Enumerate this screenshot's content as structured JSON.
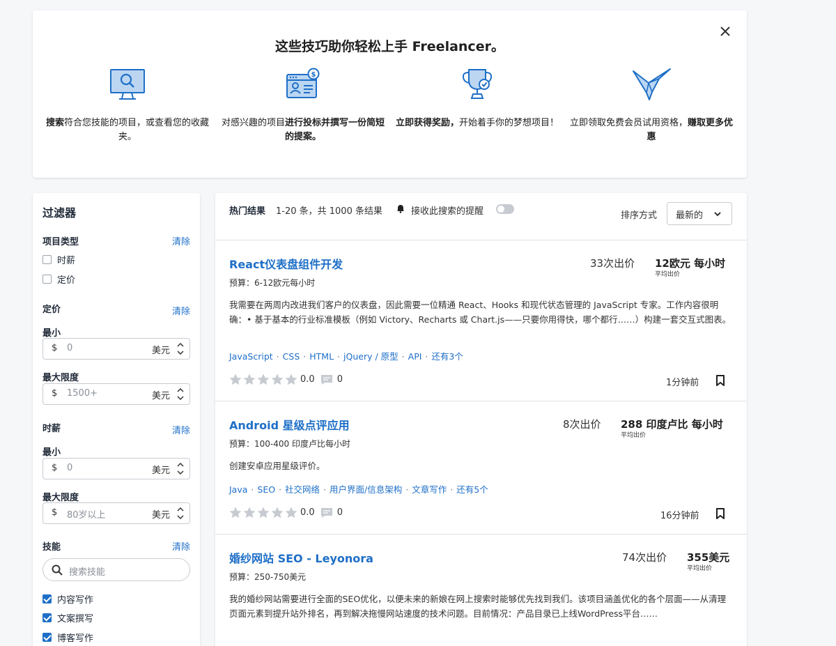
{
  "colors": {
    "accent": "#1e6fc7",
    "star": "#c7cbd1",
    "icon_fill": "#bcd6f2"
  },
  "tips": {
    "title": "这些技巧助你轻松上手 Freelancer。",
    "close_icon": "close-icon",
    "items": [
      {
        "icon": "monitor-search-icon",
        "bold1": "搜索",
        "text1": "符合您技能的项目，或查看您的收藏夹。",
        "bold2": "",
        "text2": ""
      },
      {
        "icon": "proposal-card-icon",
        "bold1": "",
        "text1": "对感兴趣的项目",
        "bold2": "进行投标并撰写一份简短的提案。",
        "text2": ""
      },
      {
        "icon": "trophy-icon",
        "bold1": "立即获得奖励，",
        "text1": "开始着手你的梦想项目！",
        "bold2": "",
        "text2": ""
      },
      {
        "icon": "bird-icon",
        "bold1": "",
        "text1": "立即领取免费会员试用资格，",
        "bold2": "赚取更多优惠",
        "text2": ""
      }
    ]
  },
  "filters": {
    "title": "过滤器",
    "project_type": {
      "label": "项目类型",
      "clear": "清除",
      "options": [
        "时薪",
        "定价"
      ]
    },
    "fixed": {
      "label": "定价",
      "clear": "清除",
      "min_label": "最小",
      "min_value": "0",
      "max_label": "最大限度",
      "max_value": "1500+",
      "currency": "$",
      "unit": "美元"
    },
    "hourly": {
      "label": "时薪",
      "clear": "清除",
      "min_label": "最小",
      "min_value": "0",
      "max_label": "最大限度",
      "max_value": "80岁以上",
      "currency": "$",
      "unit": "美元"
    },
    "skills": {
      "label": "技能",
      "clear": "清除",
      "search_placeholder": "搜索技能",
      "checked": [
        "内容写作",
        "文案撰写",
        "博客写作"
      ]
    }
  },
  "results": {
    "hot_label": "热门结果",
    "count_text": "1-20 条，共 1000 条结果",
    "alert_label": "接收此搜索的提醒",
    "sort_label": "排序方式",
    "sort_value": "最新的",
    "projects": [
      {
        "title": "React仪表盘组件开发",
        "bids": "33次出价",
        "price": "12欧元 每小时",
        "avg": "平均出价",
        "budget": "预算：6-12欧元每小时",
        "desc": "我需要在两周内改进我们客户的仪表盘，因此需要一位精通 React、Hooks 和现代状态管理的 JavaScript 专家。工作内容很明确：• 基于基本的行业标准模板（例如 Victory、Recharts 或 Chart.js——只要你用得快，哪个都行……）构建一套交互式图表。",
        "skills": [
          "JavaScript",
          "CSS",
          "HTML",
          "jQuery / 原型",
          "API",
          "还有3个"
        ],
        "rating": "0.0",
        "reviews": "0",
        "time": "1分钟前"
      },
      {
        "title": "Android 星级点评应用",
        "bids": "8次出价",
        "price": "288 印度卢比 每小时",
        "avg": "平均出价",
        "budget": "预算：100-400 印度卢比每小时",
        "desc": "创建安卓应用星级评价。",
        "skills": [
          "Java",
          "SEO",
          "社交网络",
          "用户界面/信息架构",
          "文章写作",
          "还有5个"
        ],
        "rating": "0.0",
        "reviews": "0",
        "time": "16分钟前"
      },
      {
        "title": "婚纱网站 SEO - Leyonora",
        "bids": "74次出价",
        "price": "355美元",
        "avg": "平均出价",
        "budget": "预算：250-750美元",
        "desc": "我的婚纱网站需要进行全面的SEO优化，以便未来的新娘在网上搜索时能够优先找到我们。该项目涵盖优化的各个层面——从清理页面元素到提升站外排名，再到解决拖慢网站速度的技术问题。目前情况：产品目录已上线WordPress平台……"
      }
    ]
  }
}
